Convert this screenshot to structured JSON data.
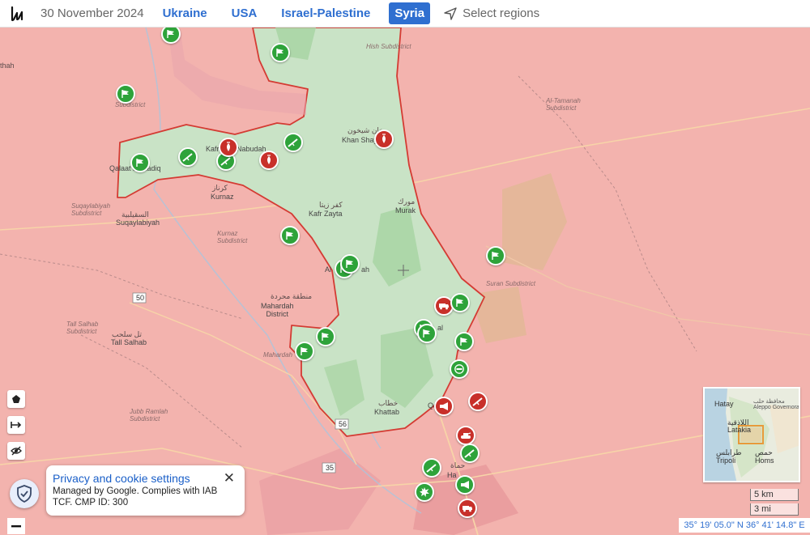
{
  "header": {
    "date": "30 November 2024",
    "regions": [
      {
        "label": "Ukraine",
        "active": false
      },
      {
        "label": "USA",
        "active": false
      },
      {
        "label": "Israel-Palestine",
        "active": false
      },
      {
        "label": "Syria",
        "active": true
      }
    ],
    "select_regions": "Select regions"
  },
  "colors": {
    "government_zone": "#f3b3ae",
    "opposition_zone": "#c9e3c6",
    "front_line": "#d43b33",
    "marker_green": "#2ea33a",
    "marker_red": "#c8302a",
    "accent": "#2f6fd0"
  },
  "places": {
    "qalaat": "Qalaat al-Madiq",
    "kafr": "Kafr",
    "kafr_suffix": "fr Nabudah",
    "kurnaz": "Kurnaz",
    "kurnaz_ar": "كرناز",
    "kurnaz_sub": "Kurnaz\nSubdistrict",
    "suqaylabiyah": "Suqaylabiyah",
    "suqaylabiyah_ar": "السقيلبية",
    "suqaylabiyah_sub": "Suqaylabiyah\nSubdistrict",
    "khan_shay": "Khan Shay",
    "khan_shay_ar": "خان شيخون",
    "kafr_zayta": "Kafr Zayta",
    "kafr_zayta_ar": "كفر زيتا",
    "murak": "Murak",
    "murak_ar": "مورك",
    "al_latamnah": "Al",
    "al_latamnah_suffix": "ah",
    "mahardah": "Mahardah\nDistrict",
    "mahardah_ar": "منطقة محردة",
    "mahardah_sub": "Mahardah",
    "tall_salhab": "Tall Salhab",
    "tall_salhab_ar": "تل سلحب",
    "tall_salhab_sub": "Tall Salhab\nSubdistrict",
    "jubb_ramlah": "Jubb Ramlah\nSubdistrict",
    "suran_sub": "Suran Subdistrict",
    "al_tamanah": "Al-Tamanah\nSubdistrict",
    "hish": "Hish Subdistrict",
    "khattab": "Khattab",
    "khattab_ar": "خطاب",
    "hama_ar": "حماة",
    "hama": "Ha",
    "road_50": "50",
    "road_56": "56",
    "road_35": "35",
    "thah": "thah",
    "subdistrict": "Subdistrict",
    "al": "al",
    "qa": "Qa"
  },
  "cookie": {
    "title": "Privacy and cookie settings",
    "text": "Managed by Google. Complies with IAB TCF. CMP ID: 300",
    "close": "✕"
  },
  "minimap": {
    "hatay": "Hatay",
    "aleppo": "محافظة حلب\nAleppo Governorate",
    "latakia": "اللاذقية\nLatakia",
    "tripoli": "طرابلس\nTripoli",
    "homs": "حمص\nHoms"
  },
  "scale": {
    "km": "5 km",
    "mi": "3 mi"
  },
  "coordinates": "35° 19' 05.0\" N 36° 41' 14.8\" E",
  "markers": [
    {
      "kind": "flag",
      "color": "green"
    },
    {
      "kind": "flag",
      "color": "green"
    },
    {
      "kind": "flag",
      "color": "green"
    },
    {
      "kind": "flag",
      "color": "green"
    },
    {
      "kind": "rifle",
      "color": "green"
    },
    {
      "kind": "rifle",
      "color": "green"
    },
    {
      "kind": "rifle",
      "color": "green"
    },
    {
      "kind": "bomb",
      "color": "red"
    },
    {
      "kind": "bomb",
      "color": "red"
    },
    {
      "kind": "bomb",
      "color": "red"
    },
    {
      "kind": "flag",
      "color": "green"
    },
    {
      "kind": "flag",
      "color": "green"
    },
    {
      "kind": "flag",
      "color": "green"
    },
    {
      "kind": "flag",
      "color": "green"
    },
    {
      "kind": "truck",
      "color": "red"
    },
    {
      "kind": "flag",
      "color": "green"
    },
    {
      "kind": "flag",
      "color": "green"
    },
    {
      "kind": "flag",
      "color": "green"
    },
    {
      "kind": "flag",
      "color": "green"
    },
    {
      "kind": "flag",
      "color": "green"
    },
    {
      "kind": "minus",
      "color": "green"
    },
    {
      "kind": "rifle",
      "color": "red"
    },
    {
      "kind": "megaphone",
      "color": "red"
    },
    {
      "kind": "tank",
      "color": "red"
    },
    {
      "kind": "rifle",
      "color": "green"
    },
    {
      "kind": "rifle",
      "color": "green"
    },
    {
      "kind": "megaphone",
      "color": "green"
    },
    {
      "kind": "explosion",
      "color": "green"
    },
    {
      "kind": "truck",
      "color": "red"
    },
    {
      "kind": "flag",
      "color": "green"
    }
  ]
}
